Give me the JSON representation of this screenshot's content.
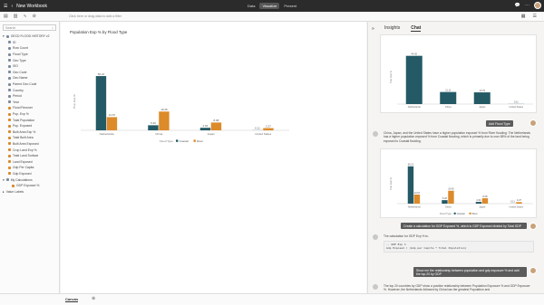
{
  "topbar": {
    "title": "New Workbook",
    "modes": [
      "Data",
      "Visualize",
      "Present"
    ],
    "active_mode": "Visualize"
  },
  "toolbar": {
    "filter_hint": "Click here or drag data to add a filter"
  },
  "sidebar": {
    "search_placeholder": "Search",
    "dataset": "OECD FLOOD HISTORY v2",
    "fields": [
      "ID",
      "Row Count",
      "Flood Type",
      "Geo Type",
      "ISO",
      "Geo Code",
      "Geo Name",
      "Parent Geo Code",
      "Country",
      "Period",
      "Year",
      "Flood Recover",
      "Pop. Exp %",
      "Total Population",
      "Pop. Exposed",
      "Built Area Exp %",
      "Total Built Area",
      "Built Area Exposed",
      "Crop Land Exp %",
      "Total Land Surface",
      "Land Exposed",
      "Gdp Per Capita",
      "Gdp Exposed"
    ],
    "my_calc": "My Calculations",
    "calc_item": "GDP Exposed %",
    "value_labels": "Value Labels"
  },
  "chart_data": {
    "type": "bar",
    "title": "Population Exp % by Flood Type",
    "ylabel": "Pop. Exp %",
    "categories": [
      "Netherlands",
      "China",
      "Japan",
      "United States"
    ],
    "series": [
      {
        "name": "Coastal",
        "values": [
          56.21,
          5.26,
          2.64,
          0.11
        ]
      },
      {
        "name": "River",
        "values": [
          13.67,
          19.45,
          8.08,
          2.27
        ]
      }
    ],
    "legend_title": "Flood Type",
    "colors": {
      "Coastal": "#245a66",
      "River": "#dd8a2a"
    }
  },
  "right": {
    "tabs": [
      "Insights",
      "Chat"
    ],
    "active_tab": "Chat",
    "mini1": {
      "values": [
        44.42,
        11.11,
        10.79,
        0.11
      ],
      "labels": [
        "Netherlands",
        "China",
        "Japan",
        "United States"
      ],
      "ylabel": "Pop. Exp %"
    },
    "user1": "Add Flood Type",
    "reply1": "China, Japan, and the United States have a higher population exposed % from River flooding. The Netherlands has a higher population exposed % from Coastal flooding, which is primarily due to over 85% of the land being exposed to Coastal flooding.",
    "user2": "Create a calculation for GDP Exposed %, which is GDP Exposed divided by Total GDP",
    "reply2": "The calculation for GDP Exp % is:",
    "code_lines": [
      "-- GDP Exp %",
      "Gdp Exposed / (Gdp per Capita * Total Population)"
    ],
    "user3": "Show me the relationship between population and gdp exposure % and add the top 20 by GDP",
    "reply3": "The top 20 countries by GDP show a positive relationship between Population Exposure % and GDP Exposure %. However, the Netherlands followed by China has the greatest Population and"
  },
  "bottom": {
    "canvas_tab": "Canvas"
  }
}
